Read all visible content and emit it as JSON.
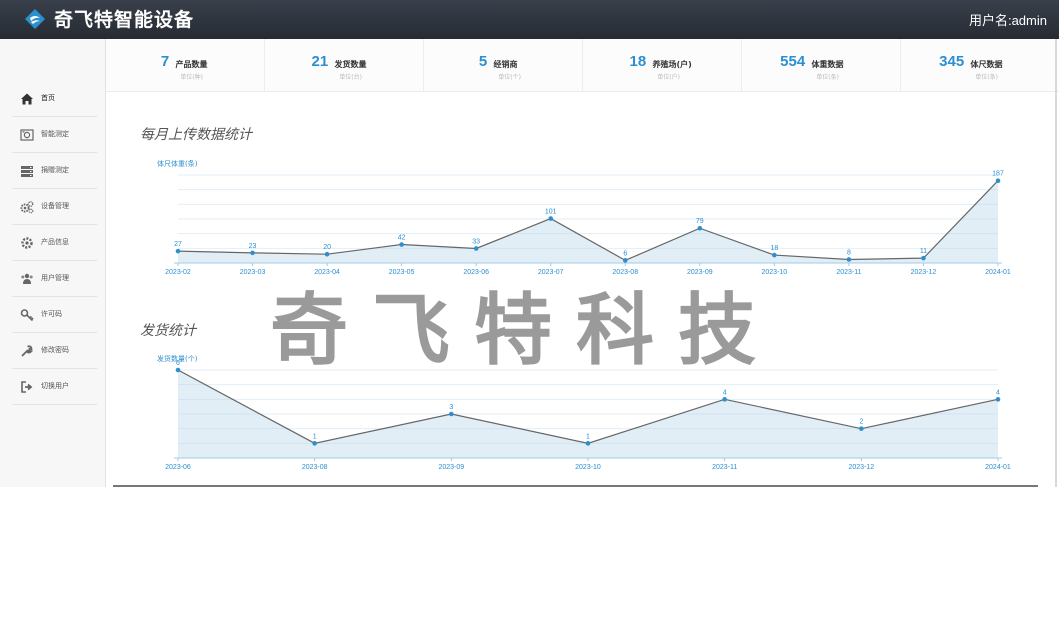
{
  "header": {
    "title": "奇飞特智能设备",
    "user": "用户名:admin",
    "brand_color": "#2b8fd0"
  },
  "sidebar": {
    "items": [
      {
        "label": "首页",
        "icon": "home-icon",
        "active": true
      },
      {
        "label": "智能测定",
        "icon": "camera-icon",
        "active": false
      },
      {
        "label": "捐赠测定",
        "icon": "server-icon",
        "active": false
      },
      {
        "label": "设备管理",
        "icon": "cogs-icon",
        "active": false
      },
      {
        "label": "产品信息",
        "icon": "gear-icon",
        "active": false
      },
      {
        "label": "用户管理",
        "icon": "users-icon",
        "active": false
      },
      {
        "label": "许可码",
        "icon": "key-icon",
        "active": false
      },
      {
        "label": "修改密码",
        "icon": "wrench-icon",
        "active": false
      },
      {
        "label": "切换用户",
        "icon": "sign-out-icon",
        "active": false
      }
    ]
  },
  "stats": [
    {
      "value": "7",
      "label": "产品数量",
      "unit": "单位(种)"
    },
    {
      "value": "21",
      "label": "发货数量",
      "unit": "单位(台)"
    },
    {
      "value": "5",
      "label": "经销商",
      "unit": "单位(个)"
    },
    {
      "value": "18",
      "label": "养殖场(户)",
      "unit": "单位(户)"
    },
    {
      "value": "554",
      "label": "体重数据",
      "unit": "单位(条)"
    },
    {
      "value": "345",
      "label": "体尺数据",
      "unit": "单位(条)"
    }
  ],
  "sections": {
    "monthly_title": "每月上传数据统计",
    "shipping_title": "发货统计"
  },
  "watermark": "奇飞特科技",
  "chart_data": [
    {
      "type": "area",
      "ylabel": "体尺体重(条)",
      "categories": [
        "2023-02",
        "2023-03",
        "2023-04",
        "2023-05",
        "2023-06",
        "2023-07",
        "2023-08",
        "2023-09",
        "2023-10",
        "2023-11",
        "2023-12",
        "2024-01"
      ],
      "values": [
        27,
        23,
        20,
        42,
        33,
        101,
        6,
        79,
        18,
        8,
        11,
        187
      ],
      "ylim": [
        0,
        200
      ],
      "grid": true,
      "line_color": "#666666",
      "point_color": "#2b8fd0"
    },
    {
      "type": "area",
      "ylabel": "发货数量(个)",
      "categories": [
        "2023-06",
        "2023-08",
        "2023-09",
        "2023-10",
        "2023-11",
        "2023-12",
        "2024-01"
      ],
      "values": [
        6,
        1,
        3,
        1,
        4,
        2,
        4
      ],
      "ylim": [
        0,
        6
      ],
      "grid": true,
      "line_color": "#666666",
      "point_color": "#2b8fd0"
    }
  ]
}
